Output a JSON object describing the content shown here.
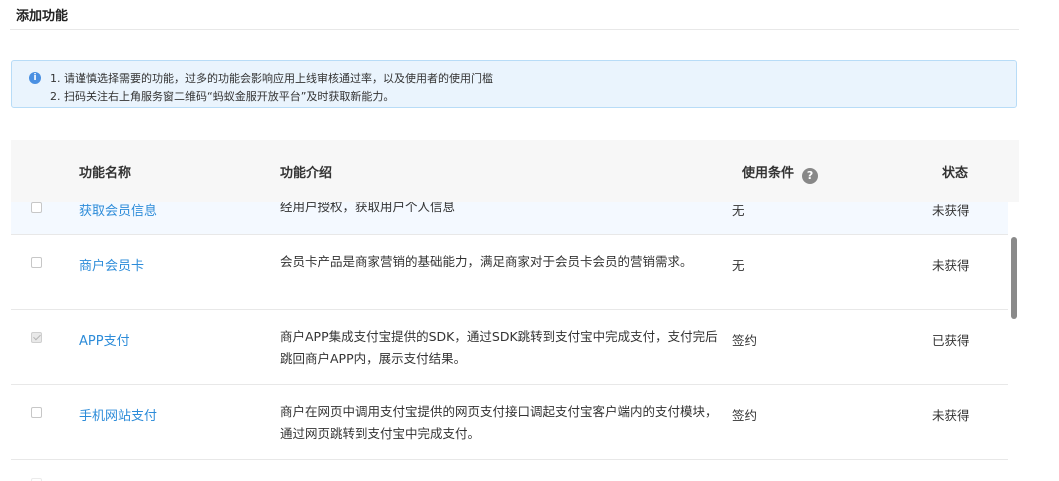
{
  "page_title": "添加功能",
  "notice": {
    "icon_text": "i",
    "line1": "1. 请谨慎选择需要的功能，过多的功能会影响应用上线审核通过率，以及使用者的使用门槛",
    "line2": "2. 扫码关注右上角服务窗二维码“蚂蚁金服开放平台”及时获取新能力。"
  },
  "table": {
    "headers": {
      "name": "功能名称",
      "desc": "功能介绍",
      "condition": "使用条件",
      "status": "状态",
      "help_icon": "?"
    },
    "rows": [
      {
        "name": "获取会员信息",
        "desc": "经用户授权，获取用户个人信息",
        "condition": "无",
        "status": "未获得",
        "checked": false
      },
      {
        "name": "商户会员卡",
        "desc": "会员卡产品是商家营销的基础能力，满足商家对于会员卡会员的营销需求。",
        "condition": "无",
        "status": "未获得",
        "checked": false
      },
      {
        "name": "APP支付",
        "desc": "商户APP集成支付宝提供的SDK，通过SDK跳转到支付宝中完成支付，支付完后跳回商户APP内，展示支付结果。",
        "condition": "签约",
        "status": "已获得",
        "checked": true
      },
      {
        "name": "手机网站支付",
        "desc": "商户在网页中调用支付宝提供的网页支付接口调起支付宝客户端内的支付模块，通过网页跳转到支付宝中完成支付。",
        "condition": "签约",
        "status": "未获得",
        "checked": false
      }
    ]
  },
  "colors": {
    "link": "#2d8cd9",
    "notice_bg": "#eaf4fd",
    "header_bg": "#f7f7f7"
  }
}
